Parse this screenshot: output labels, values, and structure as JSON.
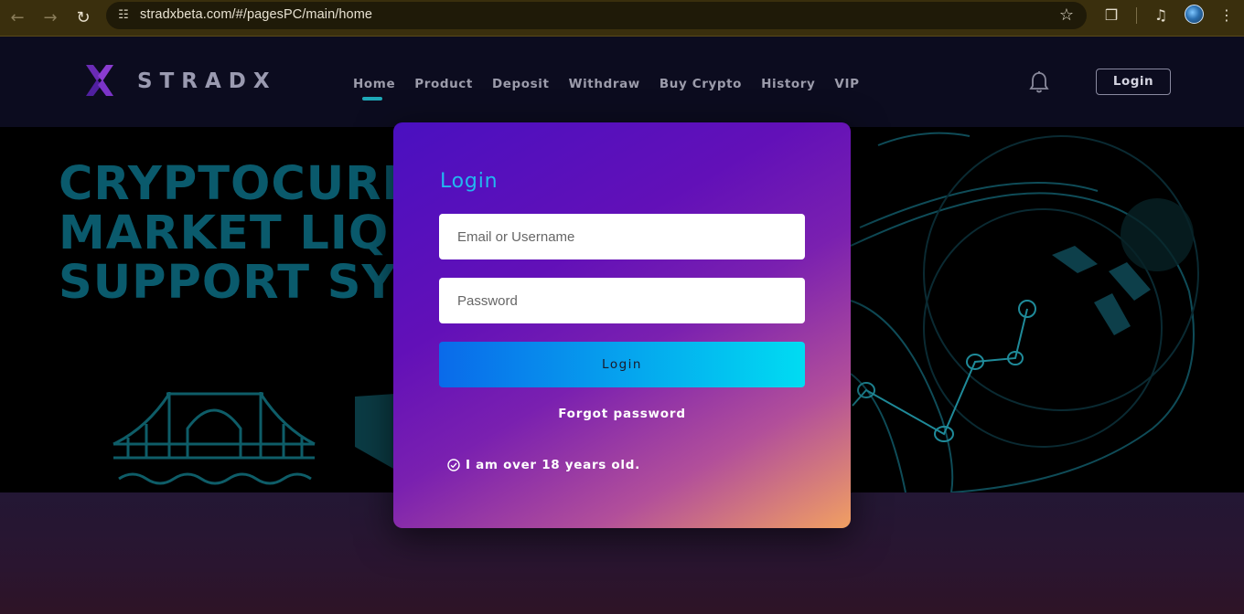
{
  "browser": {
    "url": "stradxbeta.com/#/pagesPC/main/home",
    "icons": [
      "back-icon",
      "forward-icon",
      "reload-icon",
      "site-settings-icon",
      "bookmark-star-icon",
      "extensions-icon",
      "media-control-icon",
      "profile-avatar",
      "more-menu-icon"
    ]
  },
  "header": {
    "logo_text": "STRADX",
    "nav": [
      "Home",
      "Product",
      "Deposit",
      "Withdraw",
      "Buy Crypto",
      "History",
      "VIP"
    ],
    "active_nav": "Home",
    "login_label": "Login"
  },
  "hero": {
    "lines": [
      "CRYPTOCURRENCY",
      "MARKET LIQUIDITY",
      "SUPPORT SYSTEM"
    ]
  },
  "login_modal": {
    "title": "Login",
    "email_placeholder": "Email or Username",
    "password_placeholder": "Password",
    "submit_label": "Login",
    "forgot_label": "Forgot password",
    "age_label": "I am over 18 years old."
  },
  "colors": {
    "accent": "#1fa9b8",
    "modal_gradient_start": "#4a10c0",
    "modal_gradient_end": "#f1a062",
    "button_gradient_start": "#0a6aea",
    "button_gradient_end": "#00dcf2"
  }
}
